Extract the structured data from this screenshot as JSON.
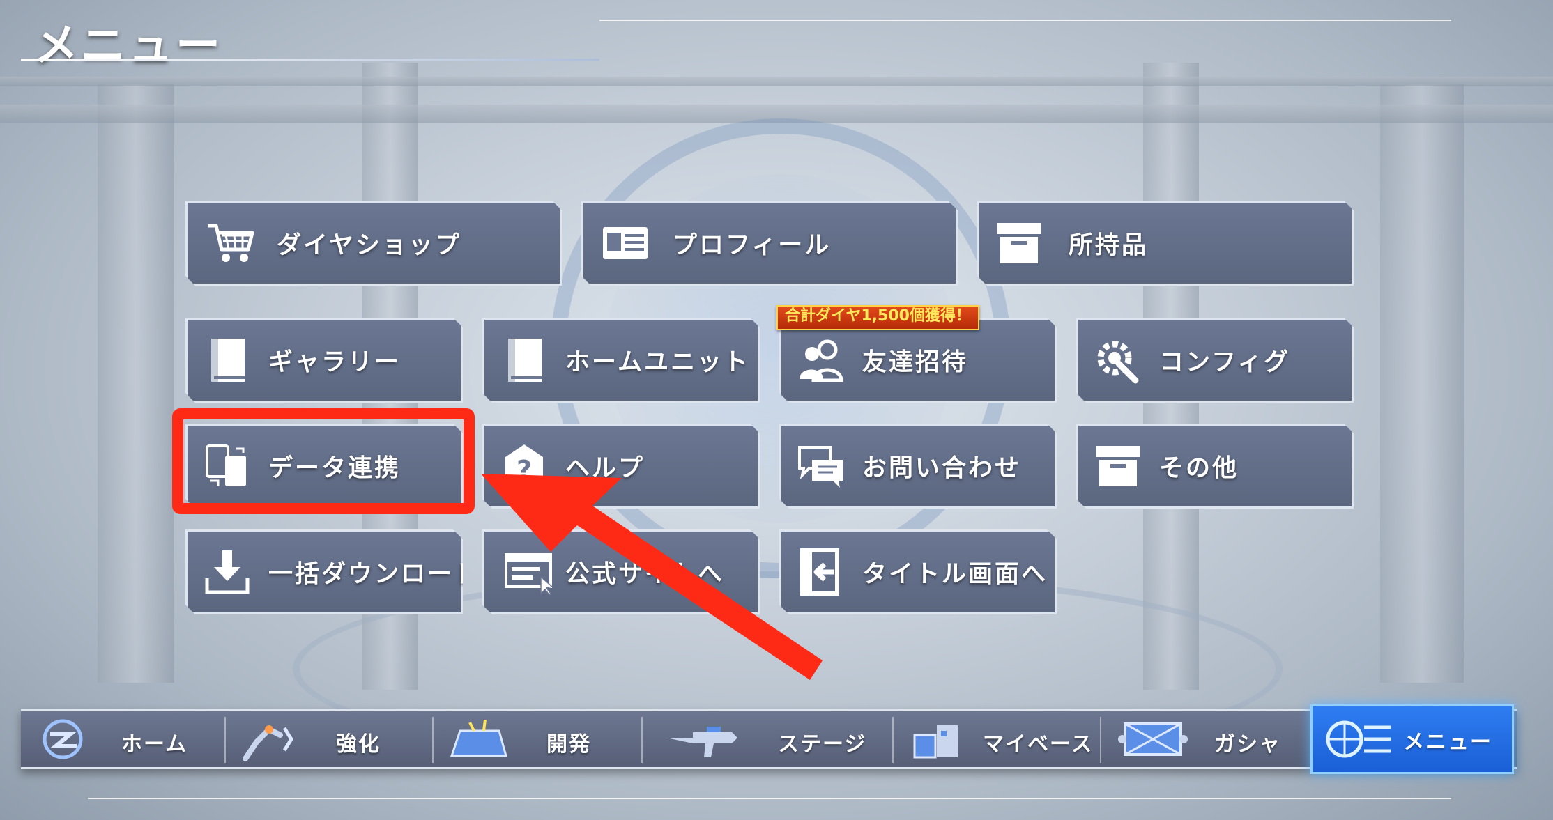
{
  "header": {
    "title": "メニュー"
  },
  "menu": {
    "items": [
      {
        "id": "diamond-shop",
        "label": "ダイヤショップ",
        "icon": "shopping-cart-icon"
      },
      {
        "id": "profile",
        "label": "プロフィール",
        "icon": "id-card-icon"
      },
      {
        "id": "inventory",
        "label": "所持品",
        "icon": "box-icon"
      },
      {
        "id": "gallery",
        "label": "ギャラリー",
        "icon": "book-icon"
      },
      {
        "id": "home-unit",
        "label": "ホームユニット",
        "icon": "book-icon"
      },
      {
        "id": "invite-friends",
        "label": "友達招待",
        "icon": "people-icon",
        "badge": "合計ダイヤ1,500個獲得！"
      },
      {
        "id": "config",
        "label": "コンフィグ",
        "icon": "gear-wrench-icon"
      },
      {
        "id": "data-link",
        "label": "データ連携",
        "icon": "devices-icon"
      },
      {
        "id": "help",
        "label": "ヘルプ",
        "icon": "question-icon"
      },
      {
        "id": "contact",
        "label": "お問い合わせ",
        "icon": "chat-bubbles-icon"
      },
      {
        "id": "other",
        "label": "その他",
        "icon": "box-icon"
      },
      {
        "id": "bulk-download",
        "label": "一括ダウンロード",
        "icon": "download-icon"
      },
      {
        "id": "official-site",
        "label": "公式サイトへ",
        "icon": "browser-icon"
      },
      {
        "id": "title-screen",
        "label": "タイトル画面へ",
        "icon": "exit-door-icon"
      }
    ]
  },
  "annotation": {
    "highlight_color": "#ff2a16"
  },
  "bottom_nav": {
    "items": [
      {
        "label": "ホーム",
        "icon": "home-emblem-icon"
      },
      {
        "label": "強化",
        "icon": "robot-arm-icon"
      },
      {
        "label": "開発",
        "icon": "blueprint-icon"
      },
      {
        "label": "ステージ",
        "icon": "gun-icon"
      },
      {
        "label": "マイベース",
        "icon": "base-icon"
      },
      {
        "label": "ガシャ",
        "icon": "gacha-icon"
      },
      {
        "label": "メニュー",
        "icon": "menu-globe-icon",
        "active": true
      }
    ]
  },
  "colors": {
    "button_bg": "#5f6a84",
    "nav_active": "#2f7df2",
    "accent_red": "#ff2a16"
  }
}
